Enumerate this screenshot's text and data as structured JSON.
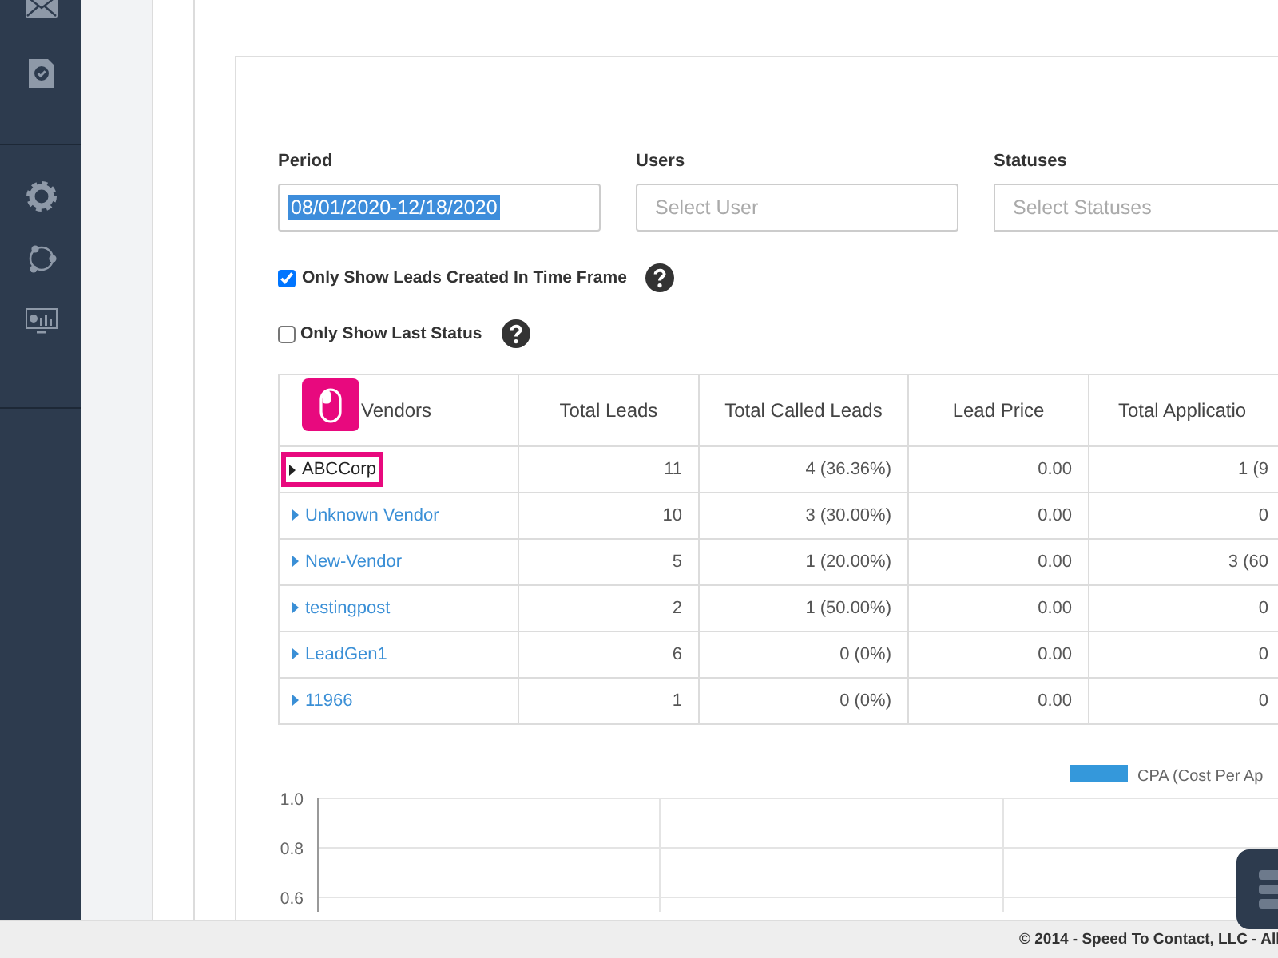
{
  "filters": [
    {
      "label": "Period",
      "value": "08/01/2020-12/18/2020",
      "text_selected": true
    },
    {
      "label": "Users",
      "placeholder": "Select User"
    },
    {
      "label": "Statuses",
      "placeholder": "Select Statuses"
    }
  ],
  "options": [
    {
      "label": "Only Show Leads Created In Time Frame",
      "checked": true
    },
    {
      "label": "Only Show Last Status",
      "checked": false
    }
  ],
  "table": {
    "columns": [
      "Vendors",
      "Total Leads",
      "Total Called Leads",
      "Lead Price",
      "Total Applicatio"
    ],
    "rows": [
      {
        "cells": [
          "ABCCorp",
          "11",
          "4 (36.36%)",
          "0.00",
          "1 (9"
        ],
        "highlighted": true
      },
      {
        "cells": [
          "Unknown Vendor",
          "10",
          "3 (30.00%)",
          "0.00",
          "0"
        ],
        "highlighted": false
      },
      {
        "cells": [
          "New-Vendor",
          "5",
          "1 (20.00%)",
          "0.00",
          "3 (60"
        ],
        "highlighted": false
      },
      {
        "cells": [
          "testingpost",
          "2",
          "1 (50.00%)",
          "0.00",
          "0"
        ],
        "highlighted": false
      },
      {
        "cells": [
          "LeadGen1",
          "6",
          "0 (0%)",
          "0.00",
          "0"
        ],
        "highlighted": false
      },
      {
        "cells": [
          "11966",
          "1",
          "0 (0%)",
          "0.00",
          "0"
        ],
        "highlighted": false
      }
    ]
  },
  "chart": {
    "chart_data": {
      "type": "bar",
      "series": [
        {
          "name": "CPA (Cost Per Ap",
          "color": "#3498db"
        }
      ],
      "ylim": [
        0.6,
        1.0
      ],
      "yticks": [
        {
          "value": 0.6,
          "label": "0.6"
        },
        {
          "value": 0.8,
          "label": "0.8"
        },
        {
          "value": 1,
          "label": "1.0"
        }
      ]
    }
  },
  "footer": "© 2014 - Speed To Contact, LLC - All"
}
